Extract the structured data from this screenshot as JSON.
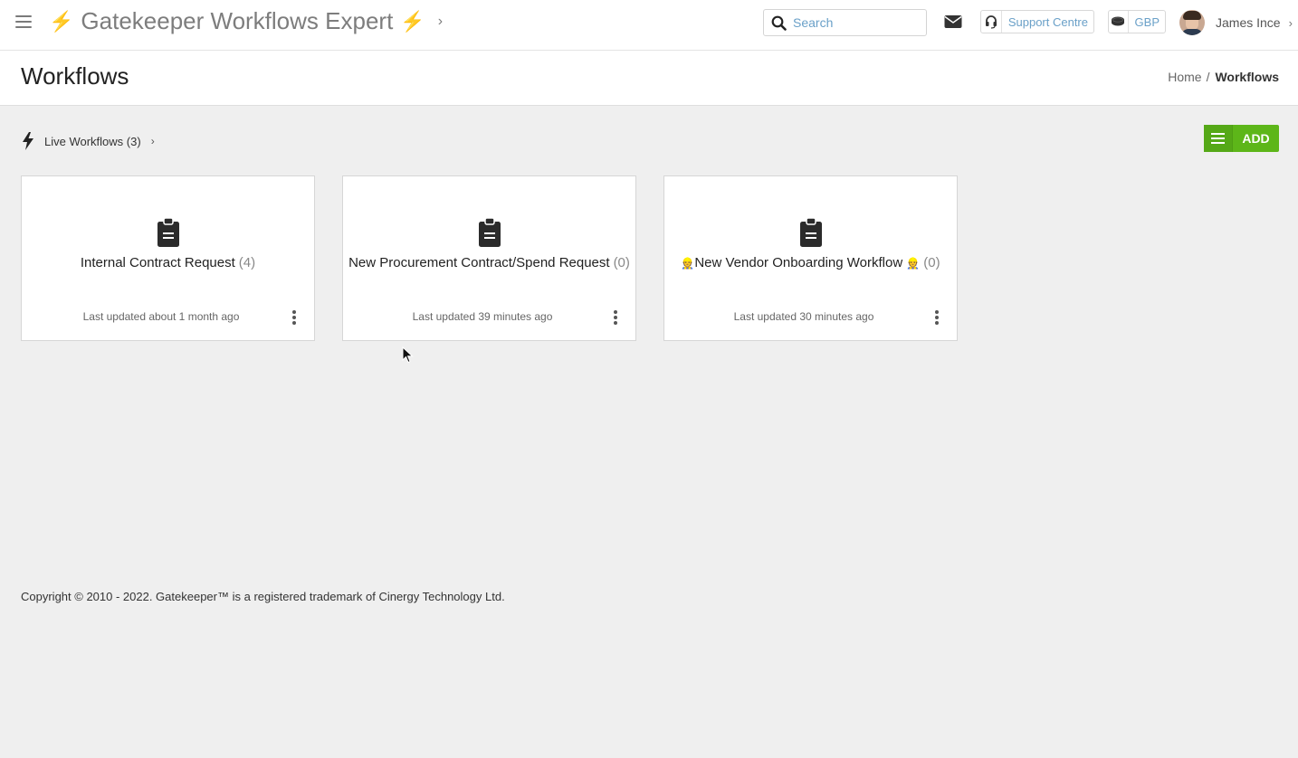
{
  "app": {
    "title": "Gatekeeper Workflows Expert",
    "title_bolt": "⚡",
    "title_chevron": "›"
  },
  "topbar": {
    "search_placeholder": "Search",
    "support_label": "Support Centre",
    "currency_label": "GBP",
    "user_name": "James Ince",
    "user_chevron": "›"
  },
  "page": {
    "title": "Workflows",
    "breadcrumb": {
      "home": "Home",
      "separator": "/",
      "current": "Workflows"
    }
  },
  "section": {
    "label": "Live Workflows (3)",
    "chevron": "›",
    "add_label": "ADD"
  },
  "cards": [
    {
      "title": "Internal Contract Request",
      "count": "(4)",
      "updated": "Last updated about 1 month ago"
    },
    {
      "title": "New Procurement Contract/Spend Request",
      "count": "(0)",
      "updated": "Last updated 39 minutes ago"
    },
    {
      "title_prefix_emoji": "👷",
      "title": "New Vendor Onboarding Workflow",
      "title_suffix_emoji": "👷",
      "count": "(0)",
      "updated": "Last updated 30 minutes ago"
    }
  ],
  "footer": {
    "copyright": "Copyright © 2010 - 2022. Gatekeeper™ is a registered trademark of Cinergy Technology Ltd."
  },
  "colors": {
    "accent_green": "#5db619",
    "bolt_yellow": "#f0b323",
    "link_blue": "#6aa0c8",
    "background": "#efefef"
  }
}
